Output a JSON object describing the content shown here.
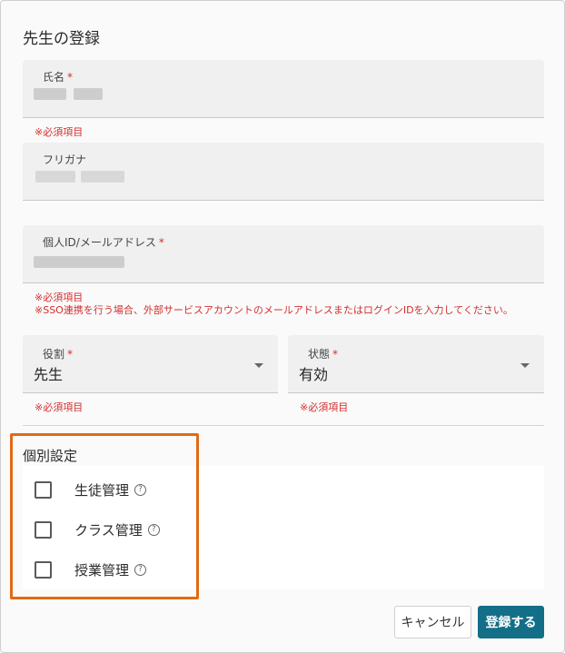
{
  "dialog": {
    "title": "先生の登録"
  },
  "required_mark": "*",
  "fields": {
    "name": {
      "label": "氏名",
      "error": "※必須項目"
    },
    "furigana": {
      "label": "フリガナ"
    },
    "personal_id": {
      "label": "個人ID/メールアドレス",
      "error_1": "※必須項目",
      "error_2": "※SSO連携を行う場合、外部サービスアカウントのメールアドレスまたはログインIDを入力してください。"
    },
    "role": {
      "label": "役割",
      "value": "先生",
      "error": "※必須項目"
    },
    "status": {
      "label": "状態",
      "value": "有効",
      "error": "※必須項目"
    }
  },
  "individual_settings": {
    "title": "個別設定",
    "items": [
      {
        "label": "生徒管理",
        "checked": false
      },
      {
        "label": "クラス管理",
        "checked": false
      },
      {
        "label": "授業管理",
        "checked": false
      }
    ],
    "help_glyph": "?"
  },
  "buttons": {
    "cancel": "キャンセル",
    "submit": "登録する"
  },
  "colors": {
    "accent": "#136e88",
    "error": "#d32f2f",
    "highlight": "#e06a14"
  }
}
